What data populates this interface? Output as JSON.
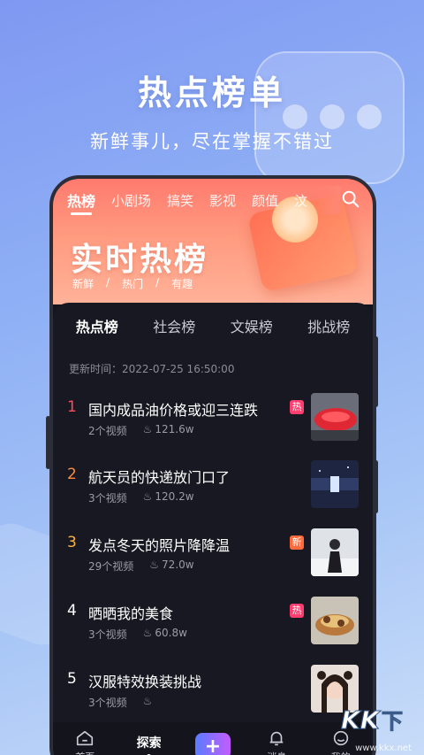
{
  "hero": {
    "title": "热点榜单",
    "subtitle": "新鲜事儿，尽在掌握不错过"
  },
  "topnav": {
    "tabs": [
      "热榜",
      "小剧场",
      "搞笑",
      "影视",
      "颜值",
      "汶"
    ],
    "active_index": 0
  },
  "banner": {
    "title": "实时热榜",
    "tags": [
      "新鲜",
      "/",
      "热门",
      "/",
      "有趣"
    ]
  },
  "subtabs": [
    "热点榜",
    "社会榜",
    "文娱榜",
    "挑战榜"
  ],
  "update_time": "更新时间：2022-07-25 16:50:00",
  "list": [
    {
      "rank": "1",
      "rank_color": "#ff4d5e",
      "title": "国内成品油价格或迎三连跌",
      "videos": "2个视频",
      "heat": "121.6w",
      "badge": "热",
      "badge_color": "#ff3d6e",
      "thumb": "red-car"
    },
    {
      "rank": "2",
      "rank_color": "#ff8a3d",
      "title": "航天员的快递放门口了",
      "videos": "3个视频",
      "heat": "120.2w",
      "badge": "",
      "badge_color": "",
      "thumb": "space"
    },
    {
      "rank": "3",
      "rank_color": "#ffb23d",
      "title": "发点冬天的照片降降温",
      "videos": "29个视频",
      "heat": "72.0w",
      "badge": "新",
      "badge_color": "#ff6a3d",
      "thumb": "winter"
    },
    {
      "rank": "4",
      "rank_color": "#ffffff",
      "title": "晒晒我的美食",
      "videos": "3个视频",
      "heat": "60.8w",
      "badge": "热",
      "badge_color": "#ff3d6e",
      "thumb": "food"
    },
    {
      "rank": "5",
      "rank_color": "#ffffff",
      "title": "汉服特效换装挑战",
      "videos": "3个视频",
      "heat": "",
      "badge": "",
      "badge_color": "",
      "thumb": "girl"
    }
  ],
  "bottombar": {
    "home": "首页",
    "explore": "探索",
    "plus": "+",
    "messages": "消息",
    "mine": "我的"
  },
  "watermark": "www.kkx.net",
  "colors": {
    "accent_gradient_start": "#5b7cff",
    "accent_gradient_end": "#c35bff",
    "header_orange": "#ff7a6e"
  }
}
